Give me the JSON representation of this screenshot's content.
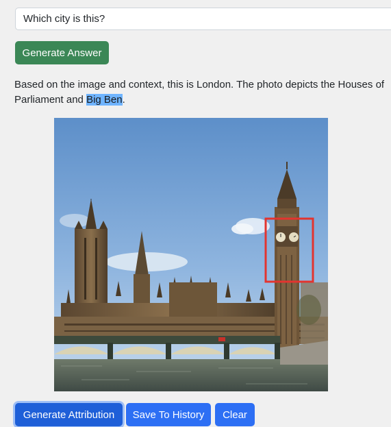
{
  "question": {
    "value": "Which city is this?",
    "placeholder": ""
  },
  "generate_answer_label": "Generate Answer",
  "answer": {
    "before": "Based on the image and context, this is London. The photo depicts the Houses of Parliament and ",
    "highlight": "Big Ben",
    "after": "."
  },
  "image": {
    "alt": "Houses of Parliament and Big Ben, London",
    "highlight_box_color": "#e3342f"
  },
  "buttons": {
    "generate_attribution": "Generate Attribution",
    "save_to_history": "Save To History",
    "clear": "Clear"
  },
  "colors": {
    "success": "#3b8756",
    "primary": "#2d6ff4",
    "highlight": "#6fb4ff"
  }
}
